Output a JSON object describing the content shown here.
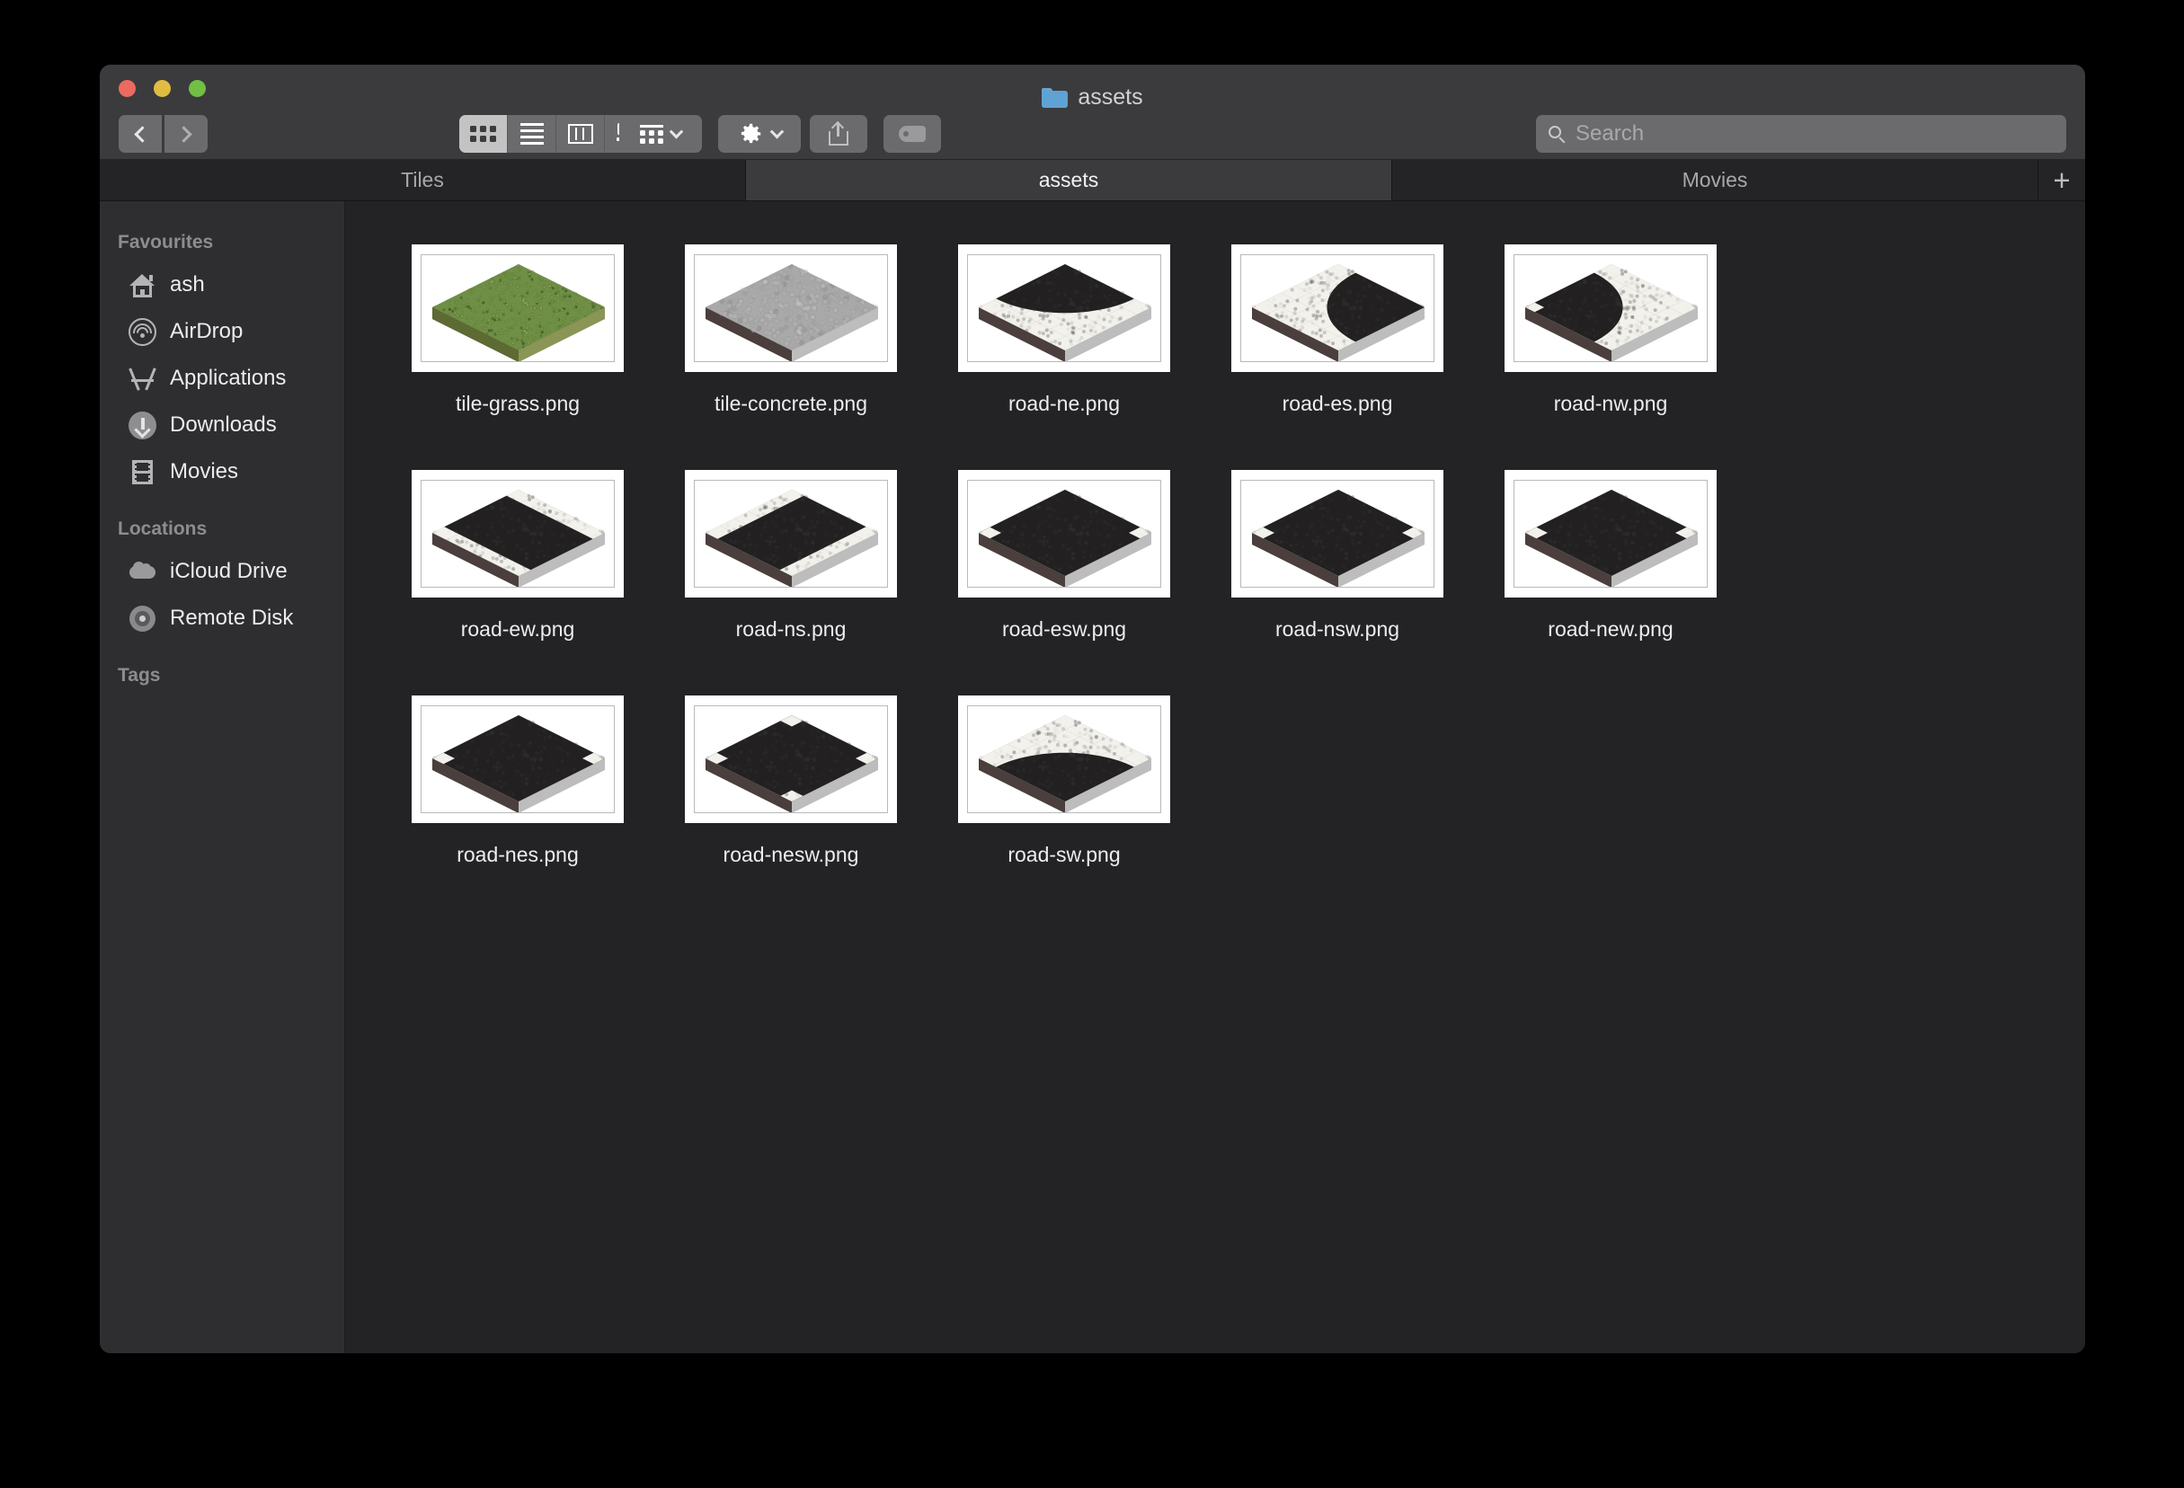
{
  "window": {
    "title": "assets",
    "title_icon": "folder-icon",
    "traffic_lights": [
      {
        "name": "close",
        "color": "#ec6a5f"
      },
      {
        "name": "minimize",
        "color": "#e0bd41"
      },
      {
        "name": "maximize",
        "color": "#72bf45"
      }
    ]
  },
  "toolbar": {
    "back_label": "Back",
    "forward_label": "Forward",
    "view_modes": [
      {
        "name": "icon-view",
        "icon": "grid-icon",
        "active": true
      },
      {
        "name": "list-view",
        "icon": "list-icon",
        "active": false
      },
      {
        "name": "column-view",
        "icon": "columns-icon",
        "active": false
      },
      {
        "name": "gallery-view",
        "icon": "gallery-icon",
        "active": false
      }
    ],
    "group_button": {
      "icon": "group-icon",
      "caret": "chevron-down-icon"
    },
    "action_button": {
      "icon": "gear-icon",
      "caret": "chevron-down-icon"
    },
    "share_button": {
      "icon": "share-icon"
    },
    "tag_button": {
      "icon": "tag-icon"
    }
  },
  "search": {
    "placeholder": "Search",
    "value": "",
    "icon": "search-icon"
  },
  "tabs": {
    "items": [
      {
        "label": "Tiles",
        "active": false
      },
      {
        "label": "assets",
        "active": true
      },
      {
        "label": "Movies",
        "active": false
      }
    ],
    "add_label": "+"
  },
  "sidebar": {
    "sections": [
      {
        "header": "Favourites",
        "items": [
          {
            "label": "ash",
            "icon": "home-icon"
          },
          {
            "label": "AirDrop",
            "icon": "airdrop-icon"
          },
          {
            "label": "Applications",
            "icon": "applications-icon"
          },
          {
            "label": "Downloads",
            "icon": "downloads-icon"
          },
          {
            "label": "Movies",
            "icon": "movies-icon"
          }
        ]
      },
      {
        "header": "Locations",
        "items": [
          {
            "label": "iCloud Drive",
            "icon": "cloud-icon"
          },
          {
            "label": "Remote Disk",
            "icon": "disk-icon"
          }
        ]
      },
      {
        "header": "Tags",
        "items": []
      }
    ]
  },
  "files": {
    "item_count": 13,
    "items": [
      {
        "name": "tile-grass.png",
        "kind": "tile",
        "surface": "grass",
        "selected": false
      },
      {
        "name": "tile-concrete.png",
        "kind": "tile",
        "surface": "concrete",
        "selected": false
      },
      {
        "name": "road-ne.png",
        "kind": "road",
        "surface": "curve",
        "curve": "ne",
        "selected": false
      },
      {
        "name": "road-es.png",
        "kind": "road",
        "surface": "curve",
        "curve": "es",
        "selected": false
      },
      {
        "name": "road-nw.png",
        "kind": "road",
        "surface": "curve",
        "curve": "nw",
        "selected": false
      },
      {
        "name": "road-ew.png",
        "kind": "road",
        "surface": "straight",
        "axis": "ew",
        "selected": false
      },
      {
        "name": "road-ns.png",
        "kind": "road",
        "surface": "straight",
        "axis": "ns",
        "selected": false
      },
      {
        "name": "road-esw.png",
        "kind": "road",
        "surface": "junction",
        "corners": 2,
        "selected": false
      },
      {
        "name": "road-nsw.png",
        "kind": "road",
        "surface": "junction",
        "corners": 2,
        "selected": false
      },
      {
        "name": "road-new.png",
        "kind": "road",
        "surface": "junction",
        "corners": 2,
        "selected": false
      },
      {
        "name": "road-nes.png",
        "kind": "road",
        "surface": "junction",
        "corners": 2,
        "selected": false
      },
      {
        "name": "road-nesw.png",
        "kind": "road",
        "surface": "junction",
        "corners": 4,
        "selected": false
      },
      {
        "name": "road-sw.png",
        "kind": "road",
        "surface": "curve",
        "curve": "sw",
        "selected": false
      }
    ]
  },
  "colors": {
    "desktop": "#000000",
    "window_chrome": "#3b3b3d",
    "window_body": "#232325",
    "sidebar": "#2e2e30",
    "tab_active": "#3b3b3d",
    "tab_inactive": "#242426",
    "text_primary": "#ededef",
    "text_secondary": "#8d8d8f",
    "folder_blue": "#5fa3d4",
    "grass_green": "#6e8f45",
    "concrete_grey": "#a9a9a9",
    "asphalt_black": "#222020",
    "sidewalk_white": "#f2f1ec"
  }
}
